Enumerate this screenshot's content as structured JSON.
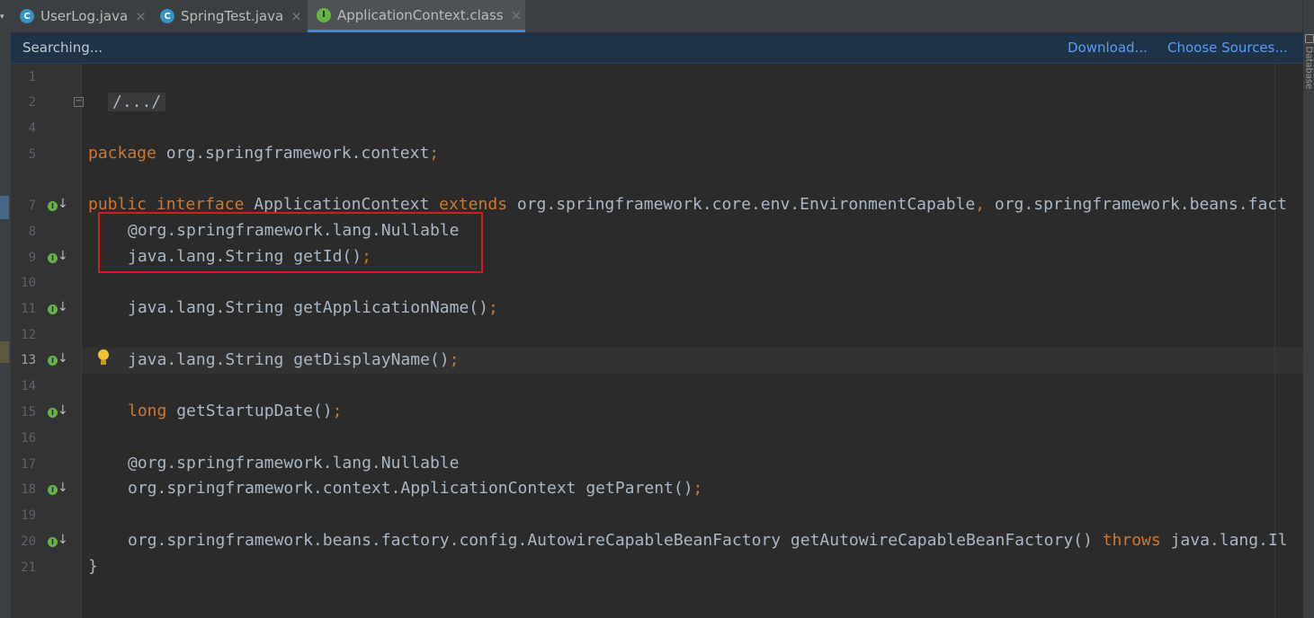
{
  "tabs": [
    {
      "label": "UserLog.java",
      "icon_glyph": "C",
      "icon": "java-class-file-icon",
      "active": false
    },
    {
      "label": "SpringTest.java",
      "icon_glyph": "C",
      "icon": "java-class-file-icon",
      "active": false
    },
    {
      "label": "ApplicationContext.class",
      "icon_glyph": "I",
      "icon": "interface-class-file-icon",
      "active": true
    }
  ],
  "tab_close_glyph": "×",
  "right_toolwindow": {
    "label": "Database"
  },
  "notification": {
    "status": "Searching...",
    "download_link": "Download...",
    "choose_sources_link": "Choose Sources..."
  },
  "editor": {
    "line_numbers": [
      "1",
      "2",
      "4",
      "5",
      "7",
      "8",
      "9",
      "10",
      "11",
      "12",
      "13",
      "14",
      "15",
      "16",
      "17",
      "18",
      "19",
      "20",
      "21"
    ],
    "current_line": "13",
    "fold_glyph": "−",
    "implementation_marker_glyph": "I",
    "implementation_arrow_glyph": "↓",
    "code": {
      "line2_folded": "/.../",
      "line5": {
        "kw": "package",
        "rest": " org.springframework.context",
        "end": ";"
      },
      "line7": {
        "kw1": "public",
        "kw2": "interface",
        "name": " ApplicationContext ",
        "kw3": "extends",
        "parent1": " org.springframework.core.env.EnvironmentCapable",
        "sep": ",",
        "parent2": " org.springframework.beans.fact"
      },
      "line8": "@org.springframework.lang.Nullable",
      "line9": {
        "text": "java.lang.String getId()",
        "end": ";"
      },
      "line11": {
        "text": "java.lang.String getApplicationName()",
        "end": ";"
      },
      "line13": {
        "text": "java.lang.String getDisplayName()",
        "end": ";"
      },
      "line15": {
        "kw": "long",
        "text": " getStartupDate()",
        "end": ";"
      },
      "line17": "@org.springframework.lang.Nullable",
      "line18": {
        "text": "org.springframework.context.ApplicationContext getParent()",
        "end": ";"
      },
      "line20": {
        "text": "org.springframework.beans.factory.config.AutowireCapableBeanFactory getAutowireCapableBeanFactory() ",
        "kw": "throws",
        "rest": " java.lang.Il"
      },
      "line21": "}"
    }
  },
  "colors": {
    "editor_background": "#2b2b2b",
    "keyword": "#cc7832",
    "plain_text": "#a9b7c6",
    "link": "#589df6",
    "annotation_box": "#e0161b",
    "notification_background": "#1f3348"
  }
}
